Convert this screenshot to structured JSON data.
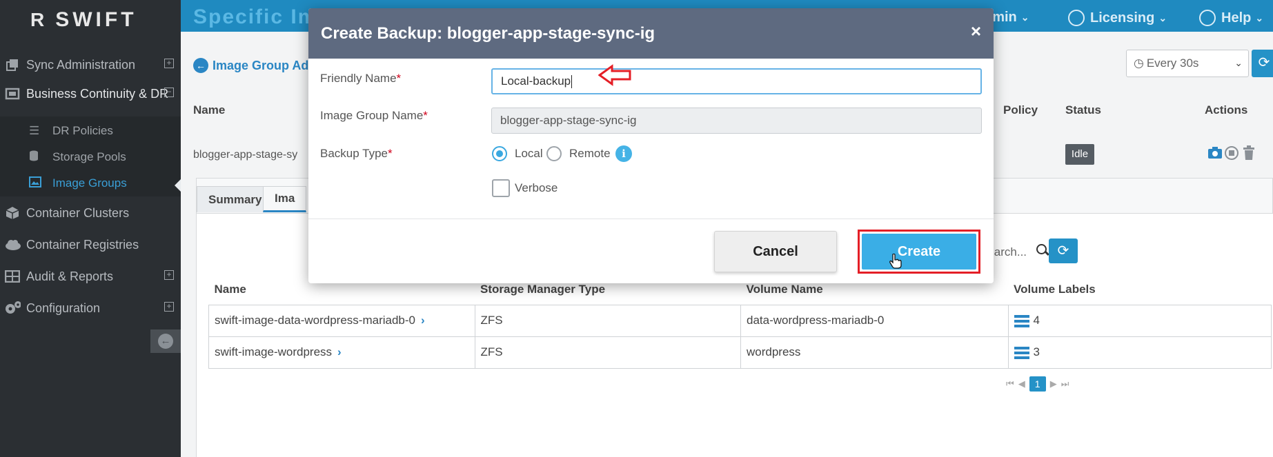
{
  "brand": {
    "logo_text": "SWIFT",
    "logo_mark": "R"
  },
  "sidebar": {
    "items": [
      {
        "label": "Sync Administration",
        "icon": "copy-icon",
        "expand": "+"
      },
      {
        "label": "Business Continuity & DR",
        "icon": "bc-dr-icon",
        "expand": "−"
      },
      {
        "label": "Container Clusters",
        "icon": "cube-icon"
      },
      {
        "label": "Container Registries",
        "icon": "cloud-icon"
      },
      {
        "label": "Audit & Reports",
        "icon": "table-icon",
        "expand": "+"
      },
      {
        "label": "Configuration",
        "icon": "gears-icon",
        "expand": "+"
      }
    ],
    "subitems": [
      {
        "label": "DR Policies",
        "icon": "list-icon"
      },
      {
        "label": "Storage Pools",
        "icon": "database-icon"
      },
      {
        "label": "Image Groups",
        "icon": "image-group-icon",
        "active": true
      }
    ]
  },
  "topbar": {
    "heading": "Specific Im",
    "admin_label": "dmin",
    "licensing_label": "Licensing",
    "help_label": "Help"
  },
  "page": {
    "breadcrumb": "Image Group Adr",
    "refresh_interval": "Every 30s",
    "table_headers": {
      "name": "Name",
      "policy": "Policy",
      "status": "Status",
      "actions": "Actions"
    },
    "row": {
      "name": "blogger-app-stage-sy",
      "status": "Idle"
    },
    "tabs": [
      {
        "label": "Summary"
      },
      {
        "label": "Ima"
      }
    ],
    "search_placeholder": "Search..."
  },
  "grid": {
    "headers": [
      "Name",
      "Storage Manager Type",
      "Volume Name",
      "Volume Labels"
    ],
    "rows": [
      {
        "name": "swift-image-data-wordpress-mariadb-0",
        "type": "ZFS",
        "volume": "data-wordpress-mariadb-0",
        "labels": "4"
      },
      {
        "name": "swift-image-wordpress",
        "type": "ZFS",
        "volume": "wordpress",
        "labels": "3"
      }
    ],
    "page": "1"
  },
  "modal": {
    "title": "Create Backup: blogger-app-stage-sync-ig",
    "close": "×",
    "friendly_name_label": "Friendly Name",
    "friendly_name_value": "Local-backup",
    "image_group_label": "Image Group Name",
    "image_group_value": "blogger-app-stage-sync-ig",
    "backup_type_label": "Backup Type",
    "required_mark": "*",
    "local_label": "Local",
    "remote_label": "Remote",
    "selected_type": "Local",
    "verbose_label": "Verbose",
    "verbose_checked": false,
    "cancel_label": "Cancel",
    "create_label": "Create"
  },
  "colors": {
    "accent": "#2a86c4",
    "create_button": "#3aaee6",
    "highlight": "#e41e26",
    "modal_header": "#5e6a80"
  }
}
